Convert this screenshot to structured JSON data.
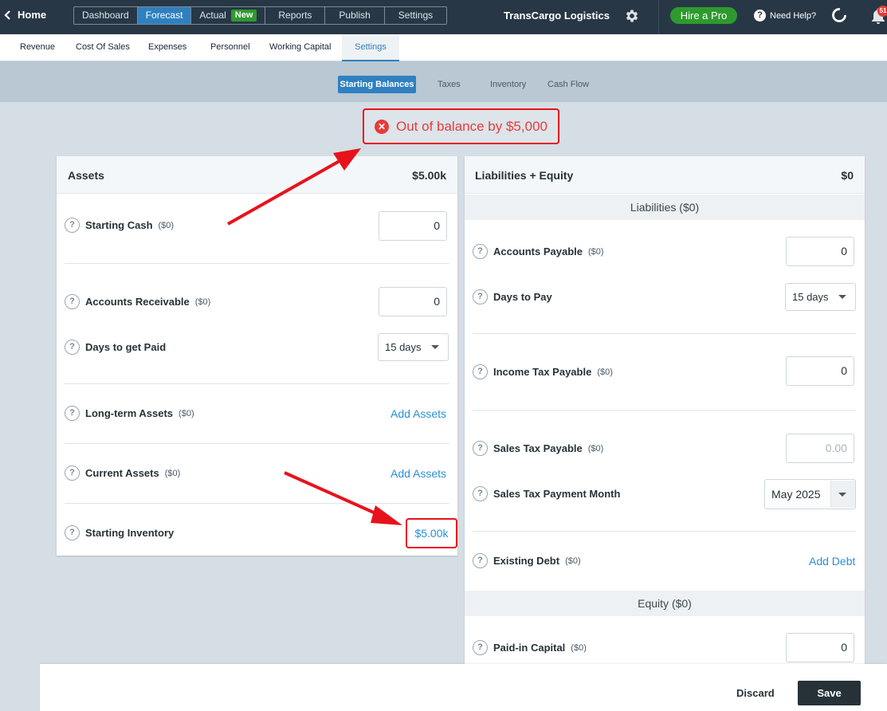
{
  "topbar": {
    "home_label": "Home",
    "nav_tabs": [
      {
        "label": "Dashboard"
      },
      {
        "label": "Forecast"
      },
      {
        "label": "Actual",
        "badge": "New"
      },
      {
        "label": "Reports"
      },
      {
        "label": "Publish"
      },
      {
        "label": "Settings"
      }
    ],
    "company": "TransCargo Logistics",
    "hire_pro": "Hire a Pro",
    "help": "Need Help?",
    "notification_count": "51"
  },
  "subnav": {
    "tabs": [
      "Revenue",
      "Cost Of Sales",
      "Expenses",
      "Personnel",
      "Working Capital",
      "Settings"
    ]
  },
  "settings_tabs": [
    "Starting Balances",
    "Taxes",
    "Inventory",
    "Cash Flow"
  ],
  "alert": {
    "text": "Out of balance by $5,000",
    "color": "#e63b3b"
  },
  "assets": {
    "title": "Assets",
    "total": "$5.00k",
    "starting_cash": {
      "label": "Starting Cash",
      "amount": "($0)",
      "value": "0"
    },
    "accounts_receivable": {
      "label": "Accounts Receivable",
      "amount": "($0)",
      "value": "0"
    },
    "days_to_get_paid": {
      "label": "Days to get Paid",
      "value": "15 days"
    },
    "long_term_assets": {
      "label": "Long-term Assets",
      "amount": "($0)",
      "link": "Add Assets"
    },
    "current_assets": {
      "label": "Current Assets",
      "amount": "($0)",
      "link": "Add Assets"
    },
    "starting_inventory": {
      "label": "Starting Inventory",
      "value": "$5.00k"
    }
  },
  "liabilities_equity": {
    "title": "Liabilities + Equity",
    "total": "$0",
    "liabilities_header": "Liabilities  ($0)",
    "accounts_payable": {
      "label": "Accounts Payable",
      "amount": "($0)",
      "value": "0"
    },
    "days_to_pay": {
      "label": "Days to Pay",
      "value": "15 days"
    },
    "income_tax_payable": {
      "label": "Income Tax Payable",
      "amount": "($0)",
      "value": "0"
    },
    "sales_tax_payable": {
      "label": "Sales Tax Payable",
      "amount": "($0)",
      "value": "0.00"
    },
    "sales_tax_payment_month": {
      "label": "Sales Tax Payment Month",
      "value": "May 2025"
    },
    "existing_debt": {
      "label": "Existing Debt",
      "amount": "($0)",
      "link": "Add Debt"
    },
    "equity_header": "Equity  ($0)",
    "paid_in_capital": {
      "label": "Paid-in Capital",
      "amount": "($0)",
      "value": "0"
    }
  },
  "footer": {
    "discard": "Discard",
    "save": "Save"
  },
  "colors": {
    "accent": "#2f80c0",
    "topbar": "#283746",
    "highlight": "#e8121b",
    "link": "#2a8fd6"
  }
}
